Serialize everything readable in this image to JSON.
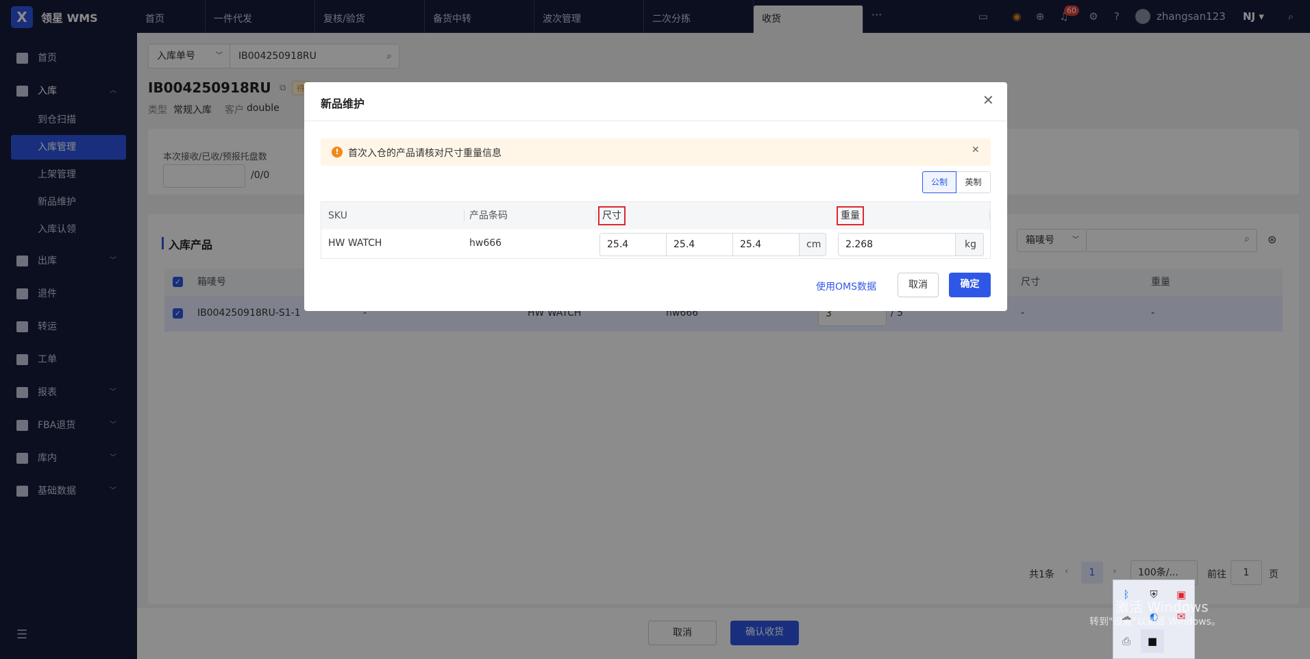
{
  "app": {
    "logo_char": "X",
    "name": "领星 WMS"
  },
  "tabs": [
    {
      "label": "首页",
      "active": false
    },
    {
      "label": "一件代发",
      "active": false
    },
    {
      "label": "复核/验货",
      "active": false
    },
    {
      "label": "备货中转",
      "active": false
    },
    {
      "label": "波次管理",
      "active": false
    },
    {
      "label": "二次分拣",
      "active": false
    },
    {
      "label": "收货",
      "active": true
    }
  ],
  "topbar": {
    "more": "···",
    "notifications": "60",
    "username": "zhangsan123",
    "org": "NJ ▾"
  },
  "sidebar": {
    "items": [
      {
        "label": "首页"
      },
      {
        "label": "入库",
        "expanded": true
      },
      {
        "label": "出库"
      },
      {
        "label": "退件"
      },
      {
        "label": "转运"
      },
      {
        "label": "工单"
      },
      {
        "label": "报表"
      },
      {
        "label": "FBA退货"
      },
      {
        "label": "库内"
      },
      {
        "label": "基础数据"
      }
    ],
    "subitems": [
      {
        "label": "到仓扫描",
        "active": false
      },
      {
        "label": "入库管理",
        "active": true
      },
      {
        "label": "上架管理",
        "active": false
      },
      {
        "label": "新品维护",
        "active": false
      },
      {
        "label": "入库认领",
        "active": false
      }
    ],
    "collapse_icon": "☰"
  },
  "search": {
    "field_select": "入库单号",
    "value": "IB004250918RU"
  },
  "order": {
    "number": "IB004250918RU",
    "status": "待",
    "type_label": "类型",
    "type_value": "常规入库",
    "customer_label": "客户",
    "customer_value": "double"
  },
  "pallet": {
    "label": "本次接收/已收/预报托盘数",
    "suffix": "/0/0"
  },
  "products": {
    "title": "入库产品",
    "box_select": "箱唛号",
    "headers": {
      "box": "箱唛号",
      "size": "尺寸",
      "weight": "重量"
    },
    "row": {
      "box": "IB004250918RU-S1-1",
      "col2": "-",
      "sku": "HW WATCH",
      "barcode": "hw666",
      "qty": "3",
      "qty_total": "/ 5",
      "size": "-",
      "weight": "-"
    }
  },
  "pagination": {
    "total": "共1条",
    "page": "1",
    "page_size": "100条/...",
    "goto_label": "前往",
    "goto_value": "1",
    "page_suffix": "页"
  },
  "footer": {
    "cancel": "取消",
    "confirm": "确认收货"
  },
  "modal": {
    "title": "新品维护",
    "alert": "首次入仓的产品请核对尺寸重量信息",
    "unit_metric": "公制",
    "unit_imperial": "英制",
    "headers": {
      "sku": "SKU",
      "barcode": "产品条码",
      "size": "尺寸",
      "weight": "重量"
    },
    "row": {
      "sku": "HW WATCH",
      "barcode": "hw666",
      "length": "25.4",
      "width": "25.4",
      "height": "25.4",
      "size_unit": "cm",
      "weight": "2.268",
      "weight_unit": "kg"
    },
    "use_oms": "使用OMS数据",
    "cancel": "取消",
    "ok": "确定"
  },
  "watermark": "激活 Windows",
  "watermark2": "转到\"设置\"以激活 Windows。",
  "colors": {
    "primary": "#2f57e6",
    "nav_bg": "#151c3a",
    "warning": "#f08a1a",
    "danger": "#e0252b"
  }
}
